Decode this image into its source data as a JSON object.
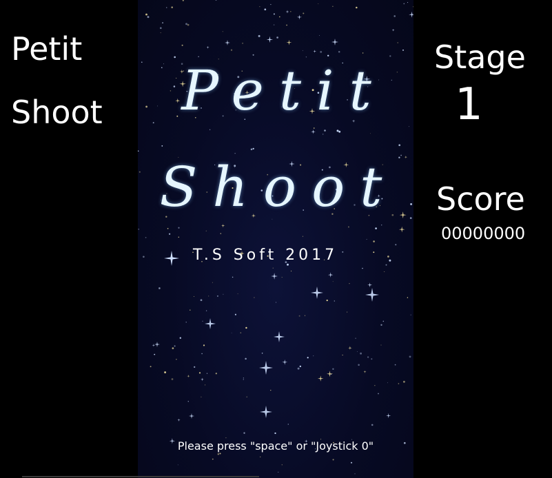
{
  "left_panel": {
    "title_line1": "Petit",
    "title_line2": "Shoot"
  },
  "right_panel": {
    "stage_label": "Stage",
    "stage_value": "1",
    "score_label": "Score",
    "score_value": "00000000"
  },
  "title_screen": {
    "logo_line1": "Petit",
    "logo_line2": "Shoot",
    "credit": "T.S Soft 2017",
    "prompt": "Please press \"space\" or \"Joystick 0\""
  },
  "colors": {
    "background": "#000000",
    "playfield": "#070a24",
    "logo_text": "#e6f6ff",
    "star_blue": "#cfe0ff",
    "star_gold": "#f3e2a0"
  }
}
